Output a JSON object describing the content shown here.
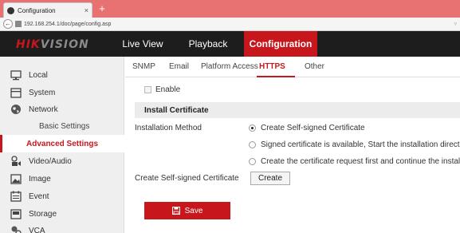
{
  "browser": {
    "tab_title": "Configuration",
    "tab_close": "×",
    "new_tab": "+",
    "url": "192.168.254.1/doc/page/config.asp",
    "back_glyph": "←"
  },
  "header": {
    "logo_red": "HIK",
    "logo_gray": "VISION",
    "nav": [
      {
        "label": "Live View"
      },
      {
        "label": "Playback"
      },
      {
        "label": "Configuration"
      }
    ]
  },
  "sidebar": {
    "items": [
      {
        "label": "Local",
        "icon": "monitor-icon"
      },
      {
        "label": "System",
        "icon": "system-icon"
      },
      {
        "label": "Network",
        "icon": "globe-icon"
      },
      {
        "label": "Basic Settings"
      },
      {
        "label": "Advanced Settings"
      },
      {
        "label": "Video/Audio",
        "icon": "video-audio-icon"
      },
      {
        "label": "Image",
        "icon": "image-icon"
      },
      {
        "label": "Event",
        "icon": "event-icon"
      },
      {
        "label": "Storage",
        "icon": "storage-icon"
      },
      {
        "label": "VCA",
        "icon": "vca-icon"
      }
    ]
  },
  "tabs": [
    {
      "label": "SNMP"
    },
    {
      "label": "Email"
    },
    {
      "label": "Platform Access"
    },
    {
      "label": "HTTPS"
    },
    {
      "label": "Other"
    }
  ],
  "form": {
    "enable_label": "Enable",
    "section_title": "Install Certificate",
    "installation_method_label": "Installation Method",
    "options": [
      {
        "label": "Create Self-signed Certificate",
        "selected": true
      },
      {
        "label": "Signed certificate is available, Start the installation directly.",
        "selected": false
      },
      {
        "label": "Create the certificate request first and continue the installation.",
        "selected": false
      }
    ],
    "self_signed_label": "Create Self-signed Certificate",
    "create_button": "Create",
    "save_button": "Save"
  },
  "colors": {
    "accent": "#c8161d",
    "header_bg": "#1d1d1d",
    "tabbar_bg": "#e87272"
  }
}
